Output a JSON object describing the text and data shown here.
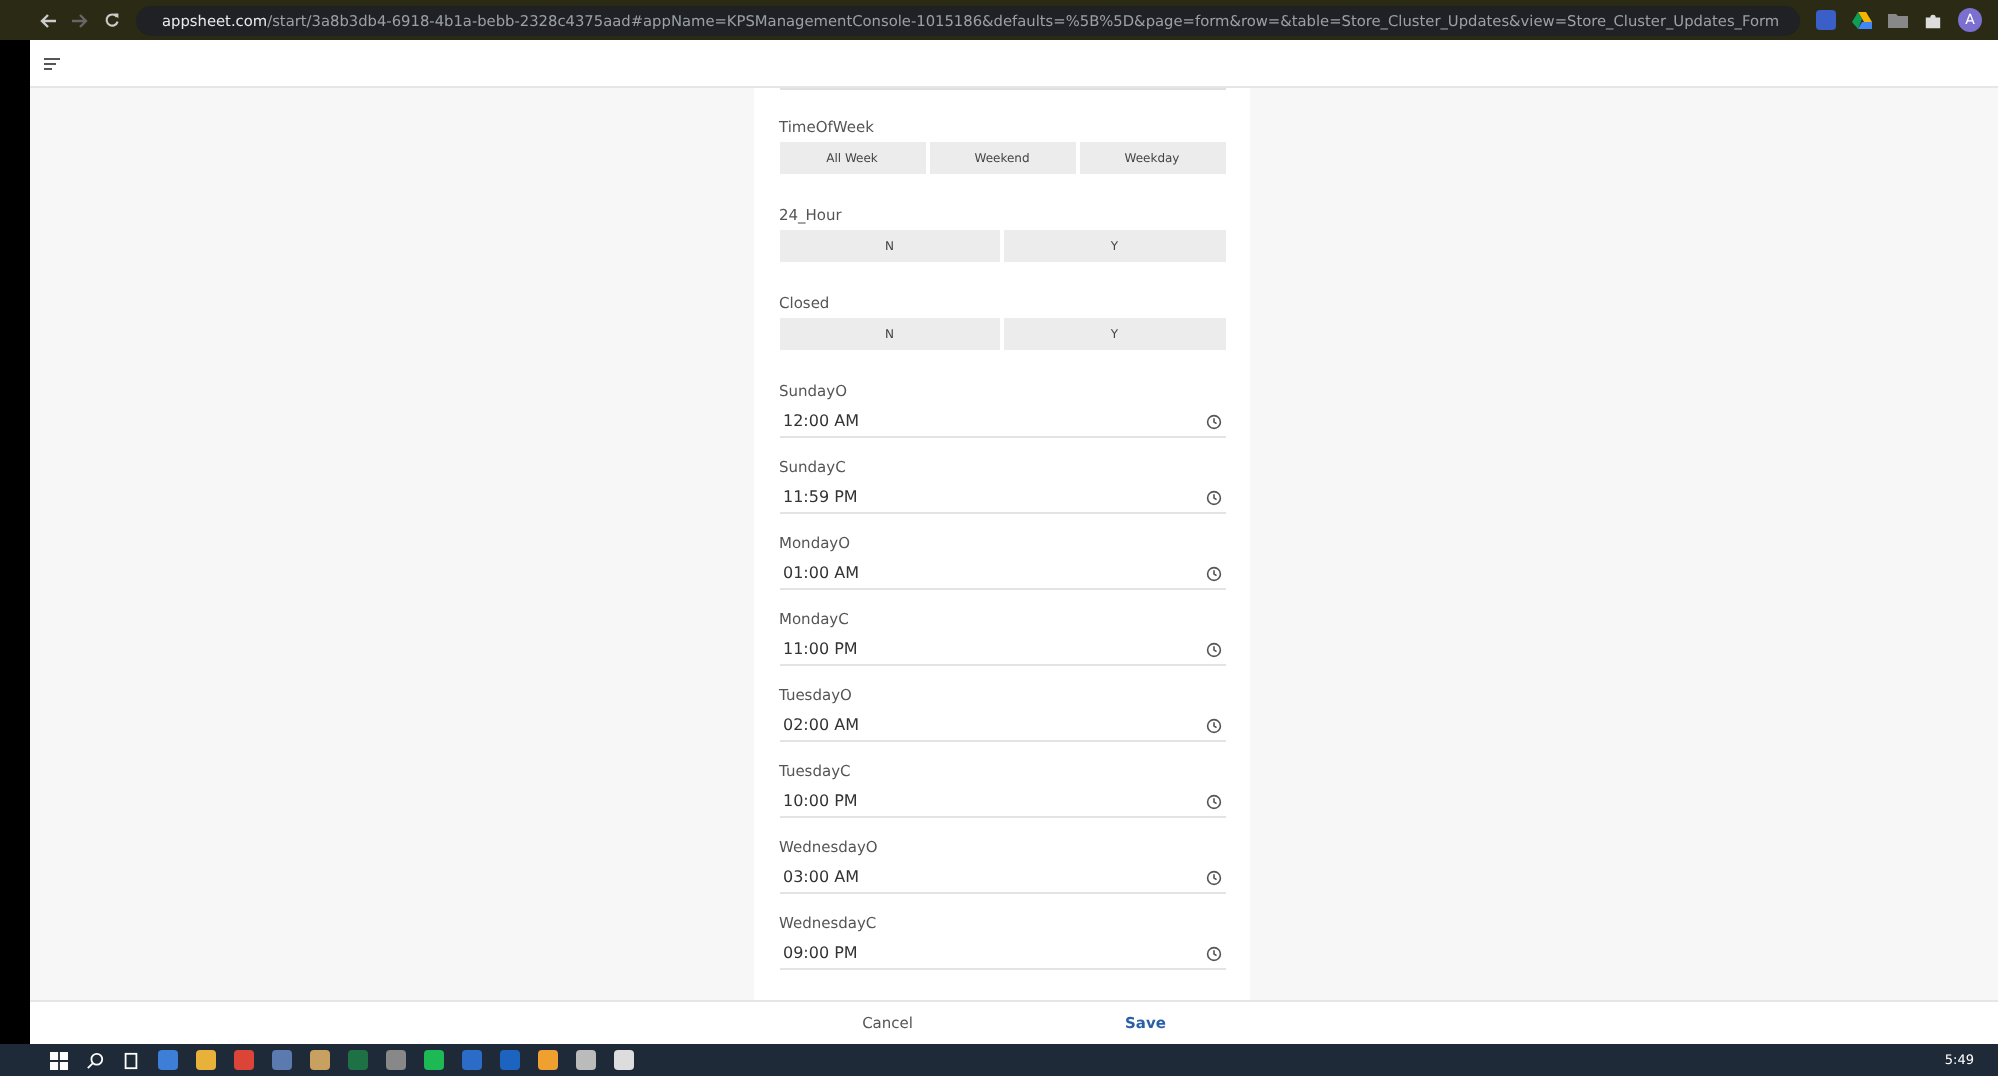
{
  "browser": {
    "url_domain": "appsheet.com",
    "url_rest": "/start/3a8b3db4-6918-4b1a-bebb-2328c4375aad#appName=KPSManagementConsole-1015186&defaults=%5B%5D&page=form&row=&table=Store_Cluster_Updates&view=Store_Cluster_Updates_Form",
    "profile_initial": "A"
  },
  "form": {
    "fields": [
      {
        "kind": "segmented",
        "label": "TimeOfWeek",
        "options": [
          "All Week",
          "Weekend",
          "Weekday"
        ]
      },
      {
        "kind": "segmented",
        "label": "24_Hour",
        "options": [
          "N",
          "Y"
        ]
      },
      {
        "kind": "segmented",
        "label": "Closed",
        "options": [
          "N",
          "Y"
        ]
      },
      {
        "kind": "time",
        "label": "SundayO",
        "value": "12:00 AM"
      },
      {
        "kind": "time",
        "label": "SundayC",
        "value": "11:59 PM"
      },
      {
        "kind": "time",
        "label": "MondayO",
        "value": "01:00 AM"
      },
      {
        "kind": "time",
        "label": "MondayC",
        "value": "11:00 PM"
      },
      {
        "kind": "time",
        "label": "TuesdayO",
        "value": "02:00 AM"
      },
      {
        "kind": "time",
        "label": "TuesdayC",
        "value": "10:00 PM"
      },
      {
        "kind": "time",
        "label": "WednesdayO",
        "value": "03:00 AM"
      },
      {
        "kind": "time",
        "label": "WednesdayC",
        "value": "09:00 PM"
      }
    ]
  },
  "footer": {
    "buttons": [
      {
        "kind": "cancel",
        "label": "Cancel"
      },
      {
        "kind": "save",
        "label": "Save"
      }
    ]
  },
  "taskbar": {
    "clock": "5:49"
  }
}
